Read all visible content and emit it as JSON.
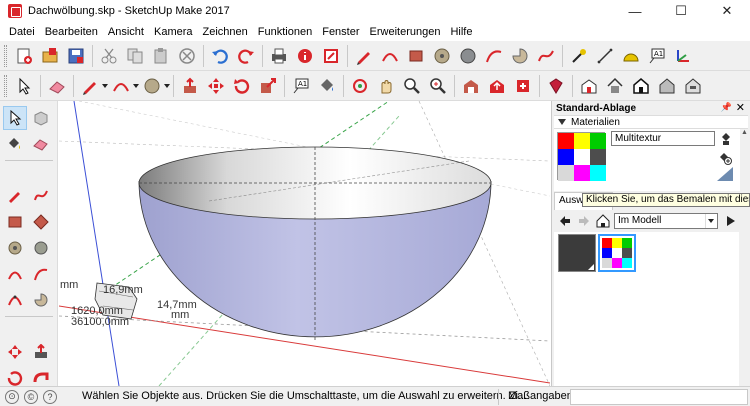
{
  "window": {
    "title": "Dachwölbung.skp - SketchUp Make 2017",
    "minimize": "—",
    "maximize": "☐",
    "close": "✕"
  },
  "menu": [
    "Datei",
    "Bearbeiten",
    "Ansicht",
    "Kamera",
    "Zeichnen",
    "Funktionen",
    "Fenster",
    "Erweiterungen",
    "Hilfe"
  ],
  "viewport": {
    "dimension_labels": [
      "mm",
      "16,9mm",
      "14,7mm",
      "1620,0mm",
      "36100,0mm",
      "mm"
    ]
  },
  "panel": {
    "tray_title": "Standard-Ablage",
    "section_title": "Materialien",
    "material_name": "Multitextur",
    "tab_select": "Auswählen",
    "tooltip": "Klicken Sie, um das Bemalen mit dieser F",
    "library_select": "Im Modell",
    "swatch_colors": [
      "#ff0000",
      "#ffff00",
      "#00cc00",
      "#0000ff",
      "#ff00ff",
      "#4d4d4d",
      "#d9d9d9",
      "#00ffff",
      "#ffffff"
    ]
  },
  "statusbar": {
    "message": "Wählen Sie Objekte aus. Drücken Sie die Umschalttaste, um die Auswahl zu erweitern. Zi...",
    "measurements_label": "Maßangaben",
    "measurements_value": ""
  },
  "colors": {
    "bowl_outer": "#b9bcdf",
    "bowl_inner": "#ffffff",
    "axis_red": "#d93a3a",
    "axis_green": "#3aa54a",
    "axis_blue": "#3b4fd6",
    "brand_red": "#d9262b"
  }
}
